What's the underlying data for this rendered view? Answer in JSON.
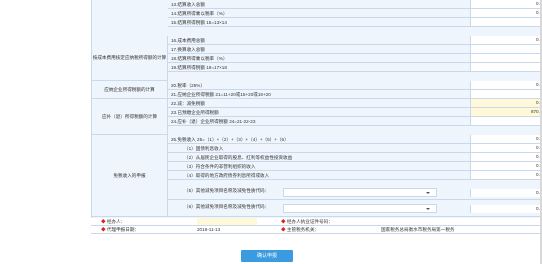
{
  "rows": [
    {
      "label": "13.结算收入总额",
      "value": "0.00",
      "hl": false,
      "sub": false
    },
    {
      "label": "14.结算所得乘以税率（%）",
      "value": "0.16",
      "hl": false,
      "sub": false
    },
    {
      "label": "15.结算所得税额 15=13×14",
      "value": "0",
      "hl": false,
      "sub": false
    },
    {
      "label": "16.成本费用总额",
      "value": "0.00",
      "hl": false,
      "sub": false
    },
    {
      "label": "17.换算收入总额",
      "value": "0",
      "hl": false,
      "sub": false
    },
    {
      "label": "18.结算所得乘以税率（%）",
      "value": "0",
      "hl": false,
      "sub": false
    },
    {
      "label": "19.结算所得税额 19=17×18",
      "value": "0",
      "hl": false,
      "sub": false
    },
    {
      "label": "20.税率（25%）",
      "value": "0.25",
      "hl": false,
      "sub": false
    },
    {
      "label": "21.应纳企业所得税额 21=11+20或15+20或19+20",
      "value": "0",
      "hl": false,
      "sub": false
    },
    {
      "label": "22.减：减免税额",
      "value": "0.00",
      "hl": true,
      "sub": false
    },
    {
      "label": "23.已预缴企业所得税额",
      "value": "870.50",
      "hl": true,
      "sub": false
    },
    {
      "label": "24.应补（退）企业所得税额 24=21-22-23",
      "value": "0",
      "hl": false,
      "sub": false
    },
    {
      "label": "25.免税收入 25=（1）+（2）+（3）+（4）+（5）+（6）",
      "value": "0.00",
      "hl": false,
      "sub": false
    },
    {
      "label": "（1）国债利息收入",
      "value": "0.00",
      "hl": false,
      "sub": true
    },
    {
      "label": "（2）从居民企业取得的股息、红利等权益性投资收益",
      "value": "0.00",
      "hl": false,
      "sub": true
    },
    {
      "label": "（3）符合条件的非营利组织的收入",
      "value": "0.00",
      "hl": false,
      "sub": true
    },
    {
      "label": "（4）取得的地方政府债券利息所得或收入",
      "value": "0.00",
      "hl": false,
      "sub": true
    },
    {
      "label": "（5）其他减免项目名称及减免性质代码：",
      "value": "0.00",
      "hl": false,
      "sub": true
    },
    {
      "label": "（6）其他减免项目名称及减免性质代码：",
      "value": "0.00",
      "hl": false,
      "sub": true
    }
  ],
  "groups": [
    {
      "label": "按成本费用核定应纳税所得额的计算"
    },
    {
      "label": "应纳企业所得税额的计算"
    },
    {
      "label": "应补（退）所得税额的计算"
    },
    {
      "label": "免税收入的申报"
    }
  ],
  "footer": {
    "agent_label": "经办人：",
    "agent_id_label": "经办人执业证件号码：",
    "date_label": "代理申报日期：",
    "date_value": "2019-11-13",
    "authority_label": "主管税务机关：",
    "authority_value": "国家税务总局衡水市税务局第一税务"
  },
  "button_label": "确认申报"
}
